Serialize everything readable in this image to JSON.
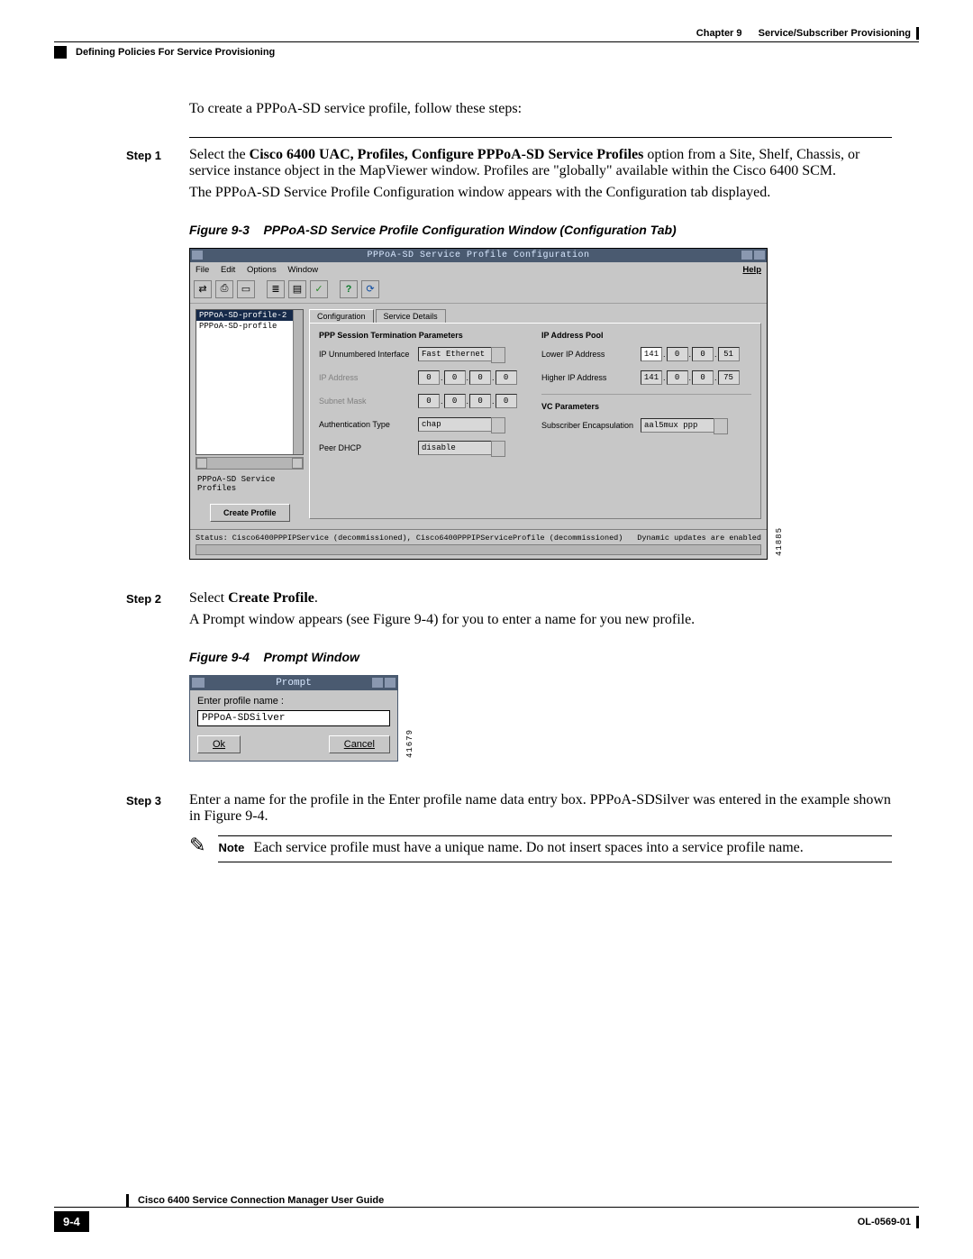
{
  "header": {
    "chapter": "Chapter 9",
    "chapter_title": "Service/Subscriber Provisioning",
    "section": "Defining Policies For Service Provisioning"
  },
  "intro": "To create a PPPoA-SD service profile, follow these steps:",
  "step1": {
    "label": "Step 1",
    "text_pre": "Select the ",
    "bold": "Cisco 6400 UAC, Profiles, Configure PPPoA-SD Service Profiles",
    "text_post": " option from a Site, Shelf, Chassis, or service instance object in the MapViewer window. Profiles are \"globally\" available within the Cisco 6400 SCM.",
    "line2": "The PPPoA-SD Service Profile Configuration window appears with the Configuration tab displayed."
  },
  "fig3": {
    "label": "Figure 9-3",
    "caption": "PPPoA-SD Service Profile Configuration Window (Configuration Tab)"
  },
  "cfg": {
    "title": "PPPoA-SD Service Profile Configuration",
    "menus": {
      "file": "File",
      "edit": "Edit",
      "options": "Options",
      "window": "Window",
      "help": "Help"
    },
    "list": {
      "sel": "PPPoA-SD-profile-2",
      "other": "PPPoA-SD-profile"
    },
    "left_label": "PPPoA-SD Service Profiles",
    "create_btn": "Create Profile",
    "tabs": {
      "config": "Configuration",
      "details": "Service Details"
    },
    "left_panel": {
      "title": "PPP Session Termination Parameters",
      "unnum_label": "IP Unnumbered Interface",
      "unnum_val": "Fast Ethernet",
      "ipaddr_label": "IP Address",
      "ip": [
        "0",
        "0",
        "0",
        "0"
      ],
      "subnet_label": "Subnet Mask",
      "mask": [
        "0",
        "0",
        "0",
        "0"
      ],
      "auth_label": "Authentication Type",
      "auth_val": "chap",
      "peer_label": "Peer DHCP",
      "peer_val": "disable"
    },
    "right_panel": {
      "pool_title": "IP Address Pool",
      "low_label": "Lower IP Address",
      "low": [
        "141",
        "0",
        "0",
        "51"
      ],
      "high_label": "Higher IP Address",
      "high": [
        "141",
        "0",
        "0",
        "75"
      ],
      "vc_title": "VC Parameters",
      "encap_label": "Subscriber Encapsulation",
      "encap_val": "aal5mux ppp"
    },
    "status_left": "Status: Cisco6400PPPIPService (decommissioned), Cisco6400PPPIPServiceProfile (decommissioned)",
    "status_right": "Dynamic updates are enabled",
    "fig_id": "41885"
  },
  "step2": {
    "label": "Step 2",
    "text_pre": "Select ",
    "bold": "Create Profile",
    "text_post": ".",
    "line2": "A Prompt window appears (see Figure 9-4) for you to enter a name for you new profile."
  },
  "fig4": {
    "label": "Figure 9-4",
    "caption": "Prompt Window"
  },
  "prompt": {
    "title": "Prompt",
    "label": "Enter profile name :",
    "value": "PPPoA-SDSilver",
    "ok": "Ok",
    "cancel": "Cancel",
    "fig_id": "41679"
  },
  "step3": {
    "label": "Step 3",
    "text": "Enter a name for the profile in the Enter profile name data entry box. PPPoA-SDSilver was entered in the example shown in Figure 9-4."
  },
  "note": {
    "label": "Note",
    "text": "Each service profile must have a unique name. Do not insert spaces into a service profile name."
  },
  "footer": {
    "guide": "Cisco 6400 Service Connection Manager User Guide",
    "page": "9-4",
    "doc": "OL-0569-01"
  }
}
